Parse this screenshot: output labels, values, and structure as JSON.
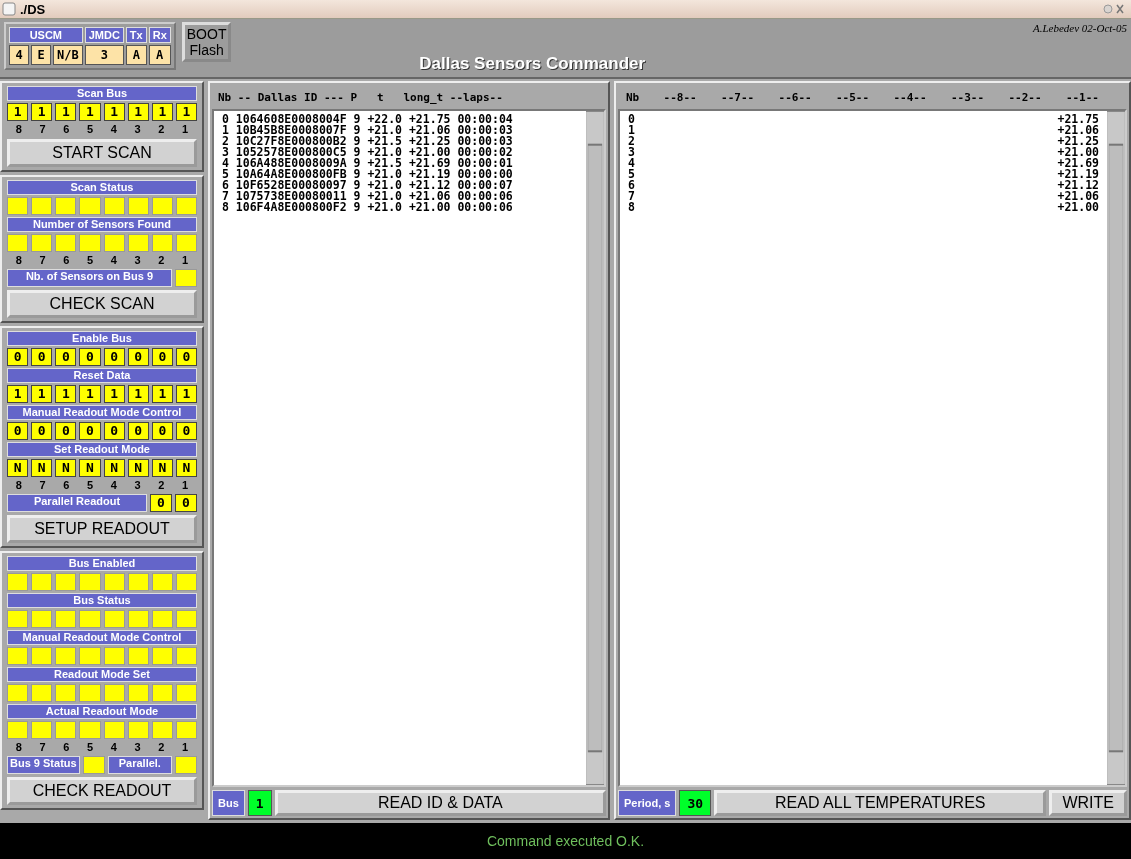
{
  "window": {
    "title": "./DS"
  },
  "header": {
    "groups": [
      {
        "label": "USCM",
        "values": [
          "4",
          "E",
          "N/B"
        ]
      },
      {
        "label": "JMDC",
        "values": [
          "3"
        ]
      },
      {
        "label": "Tx",
        "values": [
          "A"
        ]
      },
      {
        "label": "Rx",
        "values": [
          "A"
        ]
      }
    ],
    "boot_button": [
      "BOOT",
      "Flash"
    ],
    "app_title": "Dallas Sensors Commander",
    "author": "A.Lebedev 02-Oct-05"
  },
  "sidebar": [
    {
      "rows": [
        {
          "kind": "label",
          "text": "Scan Bus"
        },
        {
          "kind": "cells",
          "values": [
            "1",
            "1",
            "1",
            "1",
            "1",
            "1",
            "1",
            "1"
          ]
        },
        {
          "kind": "numbers",
          "values": [
            "8",
            "7",
            "6",
            "5",
            "4",
            "3",
            "2",
            "1"
          ]
        }
      ],
      "button": "START SCAN"
    },
    {
      "rows": [
        {
          "kind": "label",
          "text": "Scan Status"
        },
        {
          "kind": "blank"
        },
        {
          "kind": "label",
          "text": "Number of Sensors Found"
        },
        {
          "kind": "blank"
        },
        {
          "kind": "numbers",
          "values": [
            "8",
            "7",
            "6",
            "5",
            "4",
            "3",
            "2",
            "1"
          ]
        },
        {
          "kind": "inline",
          "items": [
            {
              "kind": "label",
              "text": "Nb. of Sensors on Bus 9"
            },
            {
              "kind": "blank"
            }
          ]
        }
      ],
      "button": "CHECK SCAN"
    },
    {
      "rows": [
        {
          "kind": "label",
          "text": "Enable Bus"
        },
        {
          "kind": "cells",
          "values": [
            "0",
            "0",
            "0",
            "0",
            "0",
            "0",
            "0",
            "0"
          ]
        },
        {
          "kind": "label",
          "text": "Reset Data"
        },
        {
          "kind": "cells",
          "values": [
            "1",
            "1",
            "1",
            "1",
            "1",
            "1",
            "1",
            "1"
          ]
        },
        {
          "kind": "label",
          "text": "Manual Readout Mode Control"
        },
        {
          "kind": "cells",
          "values": [
            "0",
            "0",
            "0",
            "0",
            "0",
            "0",
            "0",
            "0"
          ]
        },
        {
          "kind": "label",
          "text": "Set Readout Mode"
        },
        {
          "kind": "cells",
          "values": [
            "N",
            "N",
            "N",
            "N",
            "N",
            "N",
            "N",
            "N"
          ]
        },
        {
          "kind": "numbers",
          "values": [
            "8",
            "7",
            "6",
            "5",
            "4",
            "3",
            "2",
            "1"
          ]
        },
        {
          "kind": "inline",
          "items": [
            {
              "kind": "label",
              "text": "Parallel Readout"
            },
            {
              "kind": "cell",
              "value": "0"
            },
            {
              "kind": "cell",
              "value": "0"
            }
          ]
        }
      ],
      "button": "SETUP READOUT"
    },
    {
      "rows": [
        {
          "kind": "label",
          "text": "Bus Enabled"
        },
        {
          "kind": "blank"
        },
        {
          "kind": "label",
          "text": "Bus Status"
        },
        {
          "kind": "blank"
        },
        {
          "kind": "label",
          "text": "Manual Readout Mode Control"
        },
        {
          "kind": "blank"
        },
        {
          "kind": "label",
          "text": "Readout Mode Set"
        },
        {
          "kind": "blank"
        },
        {
          "kind": "label",
          "text": "Actual Readout Mode"
        },
        {
          "kind": "blank"
        },
        {
          "kind": "numbers",
          "values": [
            "8",
            "7",
            "6",
            "5",
            "4",
            "3",
            "2",
            "1"
          ]
        },
        {
          "kind": "inline",
          "items": [
            {
              "kind": "label",
              "text": "Bus 9 Status"
            },
            {
              "kind": "blank"
            },
            {
              "kind": "label",
              "text": "Parallel."
            },
            {
              "kind": "blank"
            }
          ]
        }
      ],
      "button": "CHECK READOUT"
    }
  ],
  "id_panel": {
    "header": "Nb -- Dallas ID --- P   t   long_t --laps--",
    "rows": [
      "0 1064608E0008004F 9 +22.0 +21.75 00:00:04",
      "1 10B45B8E0008007F 9 +21.0 +21.06 00:00:03",
      "2 10C27F8E000800B2 9 +21.5 +21.25 00:00:03",
      "3 1052578E000800C5 9 +21.0 +21.00 00:00:02",
      "4 106A488E0008009A 9 +21.5 +21.69 00:00:01",
      "5 10A64A8E000800FB 9 +21.0 +21.19 00:00:00",
      "6 10F6528E00080097 9 +21.0 +21.12 00:00:07",
      "7 1075738E00080011 9 +21.0 +21.06 00:00:06",
      "8 106F4A8E000800F2 9 +21.0 +21.00 00:00:06"
    ],
    "footer_label": "Bus",
    "footer_value": "1",
    "button": "READ ID & DATA"
  },
  "temp_panel": {
    "columns": [
      "Nb",
      "--8--",
      "--7--",
      "--6--",
      "--5--",
      "--4--",
      "--3--",
      "--2--",
      "--1--"
    ],
    "rows": [
      {
        "nb": "0",
        "value": "+21.75"
      },
      {
        "nb": "1",
        "value": "+21.06"
      },
      {
        "nb": "2",
        "value": "+21.25"
      },
      {
        "nb": "3",
        "value": "+21.00"
      },
      {
        "nb": "4",
        "value": "+21.69"
      },
      {
        "nb": "5",
        "value": "+21.19"
      },
      {
        "nb": "6",
        "value": "+21.12"
      },
      {
        "nb": "7",
        "value": "+21.06"
      },
      {
        "nb": "8",
        "value": "+21.00"
      }
    ],
    "footer_label": "Period, s",
    "footer_value": "30",
    "button": "READ ALL TEMPERATURES",
    "write_button": "WRITE"
  },
  "status_bar": "Command executed O.K."
}
